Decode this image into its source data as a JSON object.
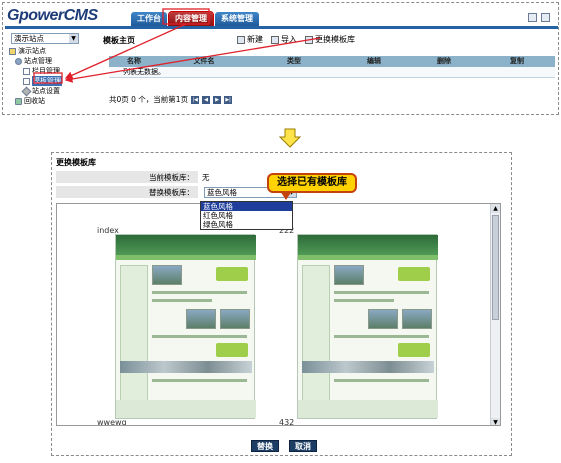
{
  "top": {
    "logo": "GpowerCMS",
    "tabs": [
      {
        "label": "工作台",
        "active": false
      },
      {
        "label": "内容管理",
        "active": true
      },
      {
        "label": "系统管理",
        "active": false
      }
    ],
    "site_select": "演示站点",
    "tree": [
      {
        "label": "演示站点",
        "icon": "site-icon",
        "level": 1
      },
      {
        "label": "站点管理",
        "icon": "gear-icon",
        "level": 2
      },
      {
        "label": "栏目管理",
        "icon": "document-icon",
        "level": 3
      },
      {
        "label": "模板管理",
        "icon": "document-icon",
        "level": 3,
        "selected": true
      },
      {
        "label": "站点设置",
        "icon": "wrench-icon",
        "level": 3
      },
      {
        "label": "回收站",
        "icon": "recycle-bin-icon",
        "level": 2
      }
    ],
    "main_title": "模板主页",
    "toolbar": {
      "new_label": "新建",
      "import_label": "导入",
      "change_label": "更换模板库"
    },
    "grid": {
      "columns": [
        "名称",
        "文件名",
        "类型",
        "编辑",
        "删除",
        "复制"
      ],
      "empty_text": "列表无数据。"
    },
    "pager_text": "共0页 0 个，当前第1页"
  },
  "dialog": {
    "title": "更换模板库",
    "current_label": "当前模板库：",
    "current_value": "无",
    "replace_label": "替换模板库：",
    "selected_value": "蓝色风格",
    "options": [
      "蓝色风格",
      "红色风格",
      "绿色风格"
    ],
    "callout": "选择已有模板库",
    "templates": [
      {
        "name": "index",
        "code": "222"
      },
      {
        "name": "wwewq",
        "code": "432"
      }
    ],
    "replace_button": "替换",
    "cancel_button": "取消"
  },
  "colors": {
    "nav_blue": "#2561a5",
    "active_tab_red": "#8a1010",
    "callout_yellow": "#ffd200",
    "callout_border": "#c4420b",
    "arrow_red": "#e0202a",
    "grid_header": "#8bb2c9"
  }
}
